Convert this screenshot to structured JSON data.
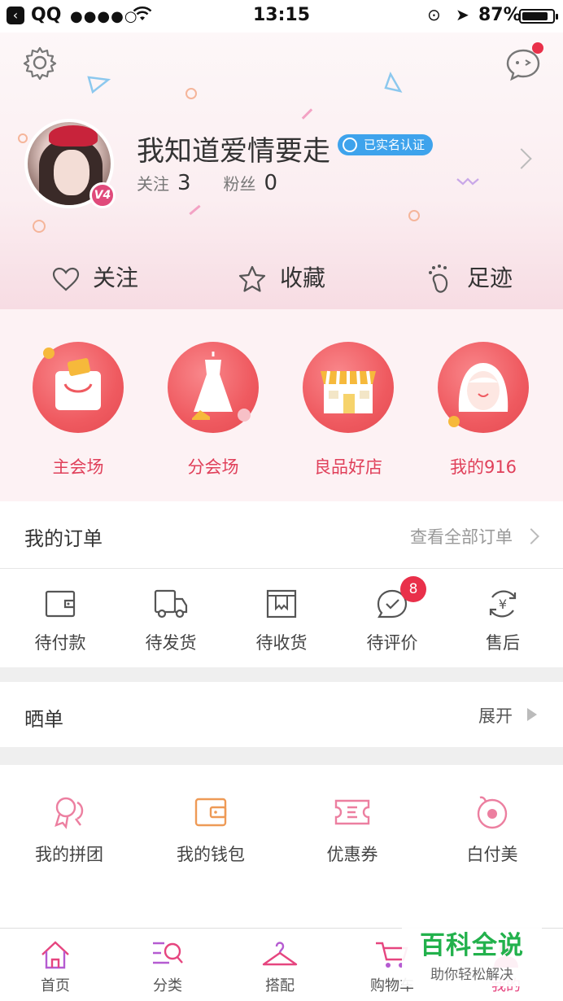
{
  "status_bar": {
    "carrier": "QQ",
    "signal": "●●●●○",
    "time": "13:15",
    "battery": "87%",
    "battery_level": 0.87
  },
  "profile": {
    "username": "我知道爱情要走",
    "verified_label": "已实名认证",
    "follow_label": "关注",
    "follow_count": "3",
    "fans_label": "粉丝",
    "fans_count": "0",
    "vip_badge": "V4"
  },
  "quick_links": [
    {
      "label": "关注",
      "icon": "heart-icon"
    },
    {
      "label": "收藏",
      "icon": "star-icon"
    },
    {
      "label": "足迹",
      "icon": "footprint-icon"
    }
  ],
  "venues": [
    {
      "label": "主会场",
      "icon": "shopping-bag-icon"
    },
    {
      "label": "分会场",
      "icon": "dress-icon"
    },
    {
      "label": "良品好店",
      "icon": "storefront-icon"
    },
    {
      "label": "我的916",
      "icon": "girl-face-icon"
    }
  ],
  "orders": {
    "title": "我的订单",
    "view_all": "查看全部订单",
    "items": [
      {
        "label": "待付款",
        "icon": "wallet-icon"
      },
      {
        "label": "待发货",
        "icon": "truck-icon"
      },
      {
        "label": "待收货",
        "icon": "box-icon"
      },
      {
        "label": "待评价",
        "icon": "comment-check-icon",
        "badge": "8"
      },
      {
        "label": "售后",
        "icon": "yen-refund-icon"
      }
    ]
  },
  "showcase": {
    "title": "晒单",
    "expand": "展开"
  },
  "tools": [
    {
      "label": "我的拼团",
      "icon": "group-icon"
    },
    {
      "label": "我的钱包",
      "icon": "wallet-icon"
    },
    {
      "label": "优惠券",
      "icon": "coupon-icon"
    },
    {
      "label": "白付美",
      "icon": "baifumei-icon"
    }
  ],
  "tabs": [
    {
      "label": "首页",
      "icon": "home-icon"
    },
    {
      "label": "分类",
      "icon": "category-search-icon"
    },
    {
      "label": "搭配",
      "icon": "hanger-icon"
    },
    {
      "label": "购物车",
      "icon": "cart-icon"
    },
    {
      "label": "我的",
      "icon": "profile-icon",
      "active": true
    }
  ],
  "watermark": {
    "title": "百科全说",
    "subtitle": "助你轻松解决"
  },
  "colors": {
    "accent": "#e6457f",
    "venue_red": "#ef5a60",
    "badge_red": "#e9304a",
    "verify_blue": "#3ea3ec",
    "watermark_green": "#22b14c"
  }
}
